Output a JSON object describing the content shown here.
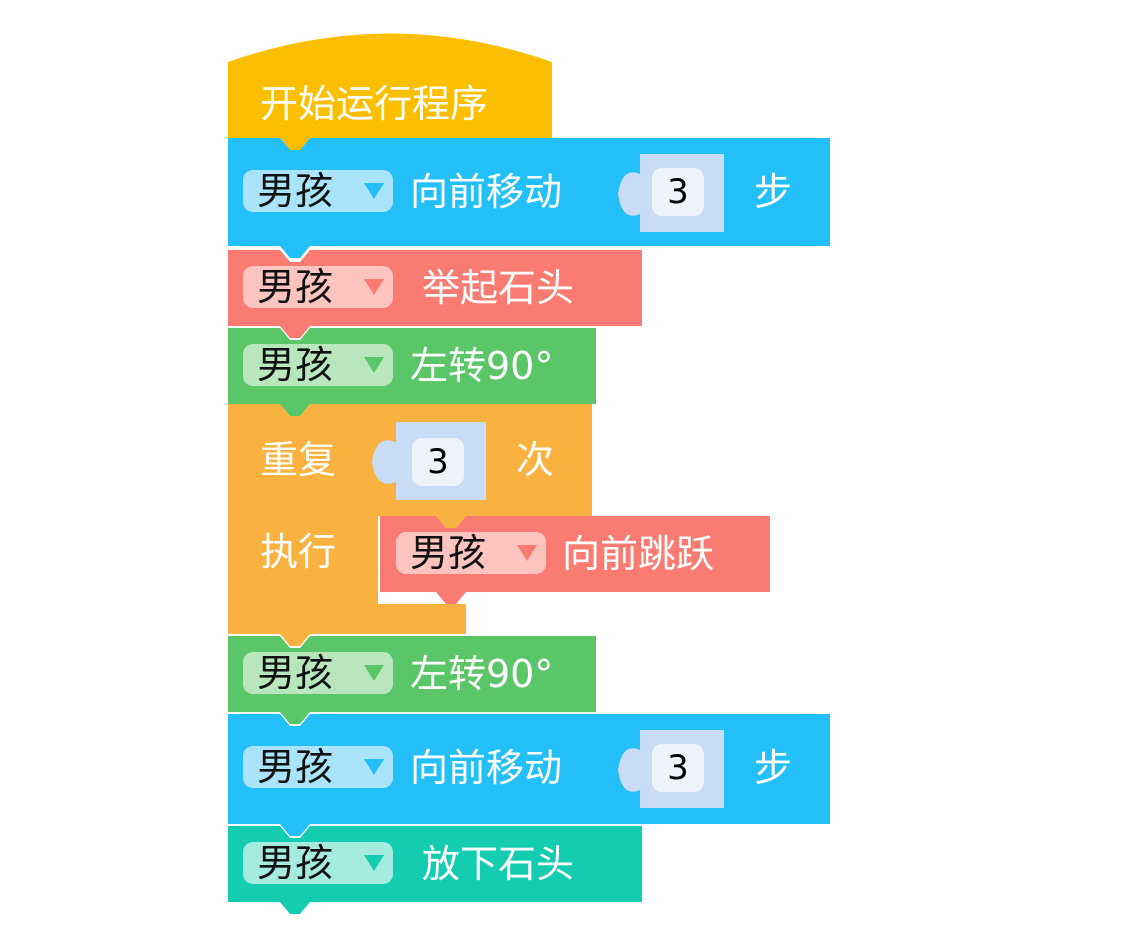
{
  "colors": {
    "start": "#fcbf00",
    "move": "#22bff8",
    "lift": "#fa7b72",
    "turn": "#5ac667",
    "repeat": "#f9b23f",
    "jump": "#fa7b72",
    "drop": "#14ccb0"
  },
  "start": {
    "label": "开始运行程序"
  },
  "blocks": [
    {
      "id": "move1",
      "actor": "男孩",
      "label": "向前移动",
      "value": "3",
      "suffix": "步"
    },
    {
      "id": "lift",
      "actor": "男孩",
      "label": "举起石头"
    },
    {
      "id": "turn1",
      "actor": "男孩",
      "label": "左转90°"
    },
    {
      "id": "repeat",
      "label": "重复",
      "value": "3",
      "suffix": "次",
      "body_label": "执行",
      "inner": {
        "actor": "男孩",
        "label": "向前跳跃"
      }
    },
    {
      "id": "turn2",
      "actor": "男孩",
      "label": "左转90°"
    },
    {
      "id": "move2",
      "actor": "男孩",
      "label": "向前移动",
      "value": "3",
      "suffix": "步"
    },
    {
      "id": "drop",
      "actor": "男孩",
      "label": "放下石头"
    }
  ]
}
